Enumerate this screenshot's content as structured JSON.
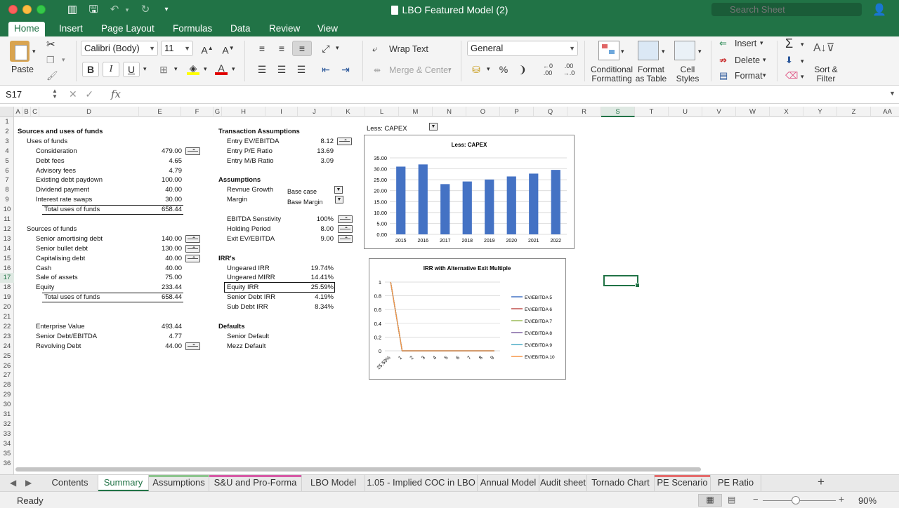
{
  "window": {
    "title": "LBO Featured Model (2)",
    "search_placeholder": "Search Sheet"
  },
  "ribbon_tabs": [
    "Home",
    "Insert",
    "Page Layout",
    "Formulas",
    "Data",
    "Review",
    "View"
  ],
  "ribbon": {
    "paste": "Paste",
    "font_name": "Calibri (Body)",
    "font_size": "11",
    "wrap_text": "Wrap Text",
    "merge_center": "Merge & Center",
    "number_format": "General",
    "conditional_formatting": [
      "Conditional",
      "Formatting"
    ],
    "format_as_table": [
      "Format",
      "as Table"
    ],
    "cell_styles": [
      "Cell",
      "Styles"
    ],
    "insert": "Insert",
    "delete": "Delete",
    "format": "Format",
    "sort_filter": [
      "Sort &",
      "Filter"
    ],
    "percent": "%",
    "bold": "B",
    "italic": "I",
    "underline": "U"
  },
  "formula_bar": {
    "name_box": "S17",
    "formula": "",
    "fx": "fx"
  },
  "columns": [
    "A",
    "B",
    "C",
    "D",
    "E",
    "F",
    "G",
    "H",
    "I",
    "J",
    "K",
    "L",
    "M",
    "N",
    "O",
    "P",
    "Q",
    "R",
    "S",
    "T",
    "U",
    "V",
    "W",
    "X",
    "Y",
    "Z",
    "AA"
  ],
  "rows": [
    "1",
    "2",
    "3",
    "4",
    "5",
    "6",
    "7",
    "8",
    "9",
    "10",
    "11",
    "12",
    "13",
    "14",
    "15",
    "16",
    "17",
    "18",
    "19",
    "20",
    "21",
    "22",
    "23",
    "24",
    "25",
    "26",
    "27",
    "28",
    "29",
    "30",
    "31",
    "32",
    "33",
    "34",
    "35",
    "36"
  ],
  "sources_uses": {
    "title": "Sources and uses of funds",
    "uses_header": "Uses of funds",
    "uses": [
      {
        "label": "Consideration",
        "value": "479.00"
      },
      {
        "label": "Debt fees",
        "value": "4.65"
      },
      {
        "label": "Advisory fees",
        "value": "4.79"
      },
      {
        "label": "Existing debt paydown",
        "value": "100.00"
      },
      {
        "label": "Dividend payment",
        "value": "40.00"
      },
      {
        "label": "Interest rate swaps",
        "value": "30.00"
      }
    ],
    "total_uses": {
      "label": "Total uses of funds",
      "value": "658.44"
    },
    "sources_header": "Sources of funds",
    "sources": [
      {
        "label": "Senior amortising debt",
        "value": "140.00"
      },
      {
        "label": "Senior bullet debt",
        "value": "130.00"
      },
      {
        "label": "Capitalising debt",
        "value": "40.00"
      },
      {
        "label": "Cash",
        "value": "40.00"
      },
      {
        "label": "Sale of assets",
        "value": "75.00"
      },
      {
        "label": "Equity",
        "value": "233.44"
      }
    ],
    "total_sources": {
      "label": "Total uses of funds",
      "value": "658.44"
    },
    "other": [
      {
        "label": "Enterprise Value",
        "value": "493.44"
      },
      {
        "label": "Senior Debt/EBITDA",
        "value": "4.77"
      },
      {
        "label": "Revolving Debt",
        "value": "44.00"
      }
    ]
  },
  "transaction": {
    "title": "Transaction Assumptions",
    "items": [
      {
        "label": "Entry EV/EBITDA",
        "value": "8.12"
      },
      {
        "label": "Entry P/E Ratio",
        "value": "13.69"
      },
      {
        "label": "Entry M/B Ratio",
        "value": "3.09"
      }
    ],
    "assumptions_title": "Assumptions",
    "revenue_growth": {
      "label": "Revnue Growth",
      "value": "Base case"
    },
    "margin": {
      "label": "Margin",
      "value": "Base Margin"
    },
    "params": [
      {
        "label": "EBITDA Senstivity",
        "value": "100%"
      },
      {
        "label": "Holding Period",
        "value": "8.00"
      },
      {
        "label": "Exit EV/EBITDA",
        "value": "9.00"
      }
    ],
    "irr_title": "IRR's",
    "irrs": [
      {
        "label": "Ungeared IRR",
        "value": "19.74%"
      },
      {
        "label": "Ungeared MIRR",
        "value": "14.41%"
      },
      {
        "label": "Equity IRR",
        "value": "25.59%"
      },
      {
        "label": "Senior Debt IRR",
        "value": "4.19%"
      },
      {
        "label": "Sub Debt IRR",
        "value": "8.34%"
      }
    ],
    "defaults_title": "Defaults",
    "defaults": [
      "Senior Default",
      "Mezz Default"
    ]
  },
  "chart_selector": "Less: CAPEX",
  "chart_data": [
    {
      "type": "bar",
      "title": "Less: CAPEX",
      "categories": [
        "2015",
        "2016",
        "2017",
        "2018",
        "2019",
        "2020",
        "2021",
        "2022"
      ],
      "values": [
        31,
        32,
        23,
        24.2,
        25.1,
        26.5,
        27.8,
        29.5
      ],
      "ylim": [
        0,
        35
      ],
      "yticks": [
        "0.00",
        "5.00",
        "10.00",
        "15.00",
        "20.00",
        "25.00",
        "30.00",
        "35.00"
      ],
      "color": "#4472c4"
    },
    {
      "type": "line",
      "title": "IRR with Alternative Exit Multiple",
      "x": [
        "25.59%",
        "1",
        "2",
        "3",
        "4",
        "5",
        "6",
        "7",
        "8",
        "9"
      ],
      "ylim": [
        0,
        1
      ],
      "yticks": [
        "0",
        "0.2",
        "0.4",
        "0.6",
        "0.8",
        "1"
      ],
      "legend_position": "right",
      "series": [
        {
          "name": "EV/EBITDA 5",
          "color": "#4472c4",
          "values": [
            1,
            0,
            0,
            0,
            0,
            0,
            0,
            0,
            0,
            0
          ]
        },
        {
          "name": "EV/EBITDA 6",
          "color": "#c0504d",
          "values": [
            1,
            0,
            0,
            0,
            0,
            0,
            0,
            0,
            0,
            0
          ]
        },
        {
          "name": "EV/EBITDA 7",
          "color": "#9bbb59",
          "values": [
            1,
            0,
            0,
            0,
            0,
            0,
            0,
            0,
            0,
            0
          ]
        },
        {
          "name": "EV/EBITDA 8",
          "color": "#8064a2",
          "values": [
            1,
            0,
            0,
            0,
            0,
            0,
            0,
            0,
            0,
            0
          ]
        },
        {
          "name": "EV/EBITDA 9",
          "color": "#4bacc6",
          "values": [
            1,
            0,
            0,
            0,
            0,
            0,
            0,
            0,
            0,
            0
          ]
        },
        {
          "name": "EV/EBITDA 10",
          "color": "#f79646",
          "values": [
            1,
            0,
            0,
            0,
            0,
            0,
            0,
            0,
            0,
            0
          ]
        }
      ]
    }
  ],
  "sheet_tabs": [
    {
      "name": "Contents",
      "color": ""
    },
    {
      "name": "Summary",
      "color": "#217346",
      "active": true
    },
    {
      "name": "Assumptions",
      "color": "#8dc58e"
    },
    {
      "name": "S&U and Pro-Forma",
      "color": "#d65aa6"
    },
    {
      "name": "LBO Model",
      "color": ""
    },
    {
      "name": "1.05 - Implied COC in LBO",
      "color": ""
    },
    {
      "name": "Annual Model",
      "color": ""
    },
    {
      "name": "Audit sheet",
      "color": ""
    },
    {
      "name": "Tornado Chart",
      "color": ""
    },
    {
      "name": "PE Scenario",
      "color": "#e46c6c"
    },
    {
      "name": "PE Ratio",
      "color": ""
    }
  ],
  "status": {
    "ready": "Ready",
    "zoom": "90%"
  }
}
